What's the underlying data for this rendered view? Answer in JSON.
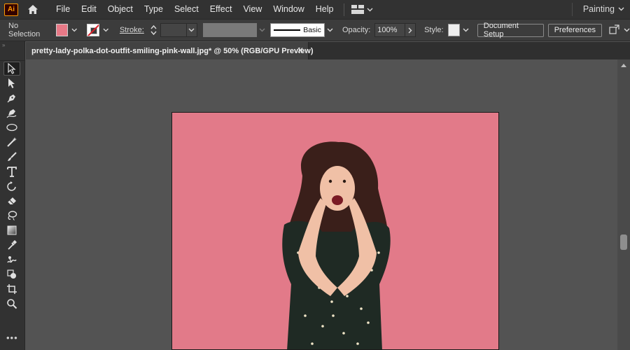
{
  "app": {
    "logo_text": "Ai",
    "workspace": "Painting"
  },
  "menu": [
    "File",
    "Edit",
    "Object",
    "Type",
    "Select",
    "Effect",
    "View",
    "Window",
    "Help"
  ],
  "control": {
    "selection": "No Selection",
    "fill_color": "#e87987",
    "stroke_label": "Stroke:",
    "brush_label": "Basic",
    "opacity_label": "Opacity:",
    "opacity_value": "100%",
    "style_label": "Style:",
    "document_setup": "Document Setup",
    "preferences": "Preferences"
  },
  "document": {
    "tab_title": "pretty-lady-polka-dot-outfit-smiling-pink-wall.jpg* @ 50% (RGB/GPU Preview)",
    "artboard_bg": "#e27a89"
  },
  "tools": [
    "selection-tool-icon",
    "direct-selection-tool-icon",
    "pen-tool-icon",
    "curvature-tool-icon",
    "ellipse-tool-icon",
    "magic-wand-tool-icon",
    "paintbrush-tool-icon",
    "type-tool-icon",
    "rotate-tool-icon",
    "eraser-tool-icon",
    "lasso-tool-icon",
    "gradient-tool-icon",
    "eyedropper-tool-icon",
    "puppet-warp-tool-icon",
    "shape-builder-tool-icon",
    "artboard-tool-icon",
    "zoom-tool-icon"
  ],
  "tools_more": "•••"
}
